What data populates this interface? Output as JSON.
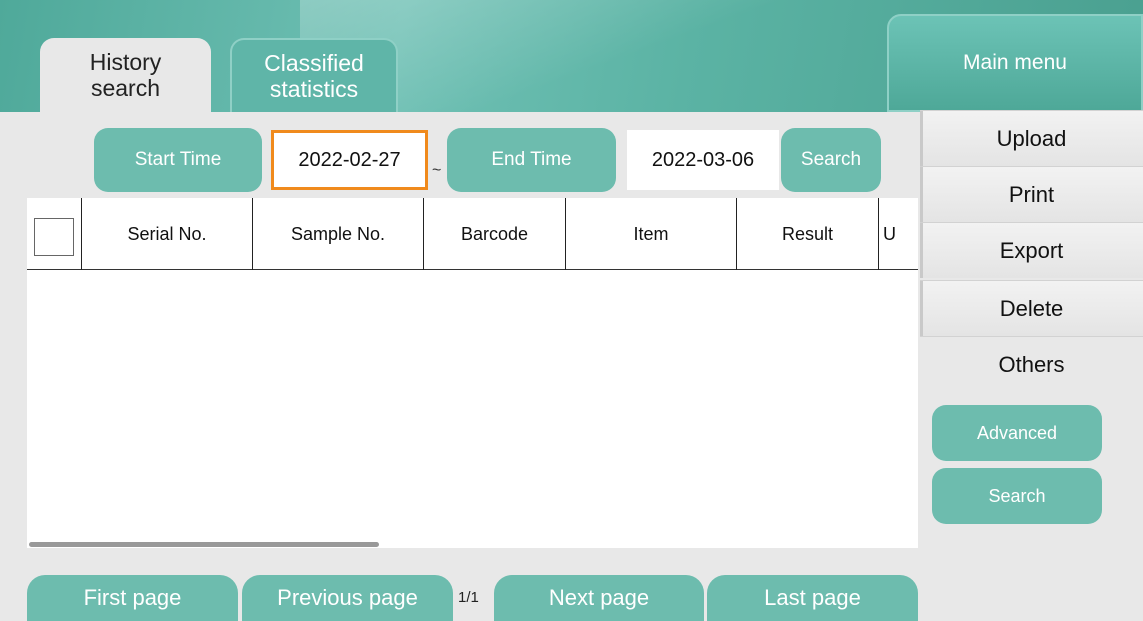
{
  "tabs": [
    {
      "label": "History\nsearch",
      "active": true
    },
    {
      "label": "Classified\nstatistics",
      "active": false
    }
  ],
  "main_menu": "Main menu",
  "filter": {
    "start_label": "Start Time",
    "start_value": "2022-02-27",
    "separator": "~",
    "end_label": "End Time",
    "end_value": "2022-03-06",
    "search_label": "Search"
  },
  "table": {
    "columns": [
      "Serial No.",
      "Sample No.",
      "Barcode",
      "Item",
      "Result",
      "U"
    ],
    "rows": []
  },
  "side_menu": [
    "Upload",
    "Print",
    "Export",
    "Delete",
    "Others"
  ],
  "side_buttons": {
    "advanced": "Advanced",
    "search": "Search"
  },
  "pager": {
    "first": "First page",
    "previous": "Previous page",
    "indicator": "1/1",
    "next": "Next page",
    "last": "Last page"
  },
  "colors": {
    "accent": "#6dbcae",
    "focus": "#f08a1c",
    "background": "#e8e8e8"
  }
}
